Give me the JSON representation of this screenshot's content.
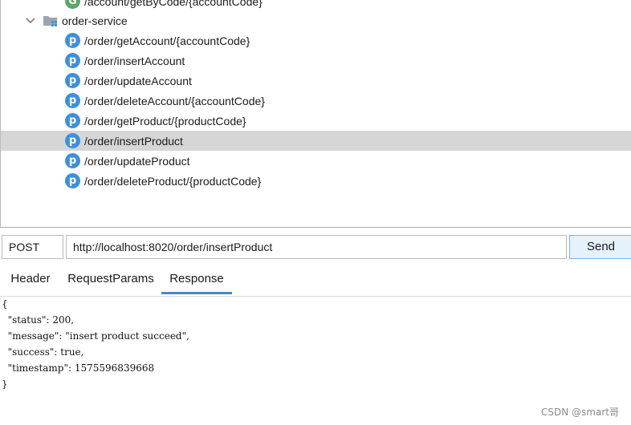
{
  "tree": {
    "partial_top": {
      "badge": "G",
      "label": "/account/getByCode/{accountCode}"
    },
    "service": {
      "label": "order-service"
    },
    "endpoints": [
      {
        "badge": "p",
        "label": "/order/getAccount/{accountCode}"
      },
      {
        "badge": "p",
        "label": "/order/insertAccount"
      },
      {
        "badge": "p",
        "label": "/order/updateAccount"
      },
      {
        "badge": "p",
        "label": "/order/deleteAccount/{accountCode}"
      },
      {
        "badge": "p",
        "label": "/order/getProduct/{productCode}"
      },
      {
        "badge": "p",
        "label": "/order/insertProduct"
      },
      {
        "badge": "p",
        "label": "/order/updateProduct"
      },
      {
        "badge": "p",
        "label": "/order/deleteProduct/{productCode}"
      }
    ],
    "selected_label": "/order/insertProduct"
  },
  "request": {
    "method": "POST",
    "url": "http://localhost:8020/order/insertProduct",
    "send_label": "Send"
  },
  "tabs": [
    {
      "label": "Header"
    },
    {
      "label": "RequestParams"
    },
    {
      "label": "Response"
    }
  ],
  "active_tab": "Response",
  "response_lines": [
    "{",
    "  \"status\": 200,",
    "  \"message\": \"insert product succeed\",",
    "  \"success\": true,",
    "  \"timestamp\": 1575596839668",
    "}"
  ],
  "watermark": "CSDN @smart哥",
  "colors": {
    "badge_p": "#3d8fe0",
    "badge_g": "#59a869",
    "selected_row": "#d6d6d6",
    "active_tab_underline": "#4a88c7",
    "send_button_bg": "#e5f1fb"
  }
}
